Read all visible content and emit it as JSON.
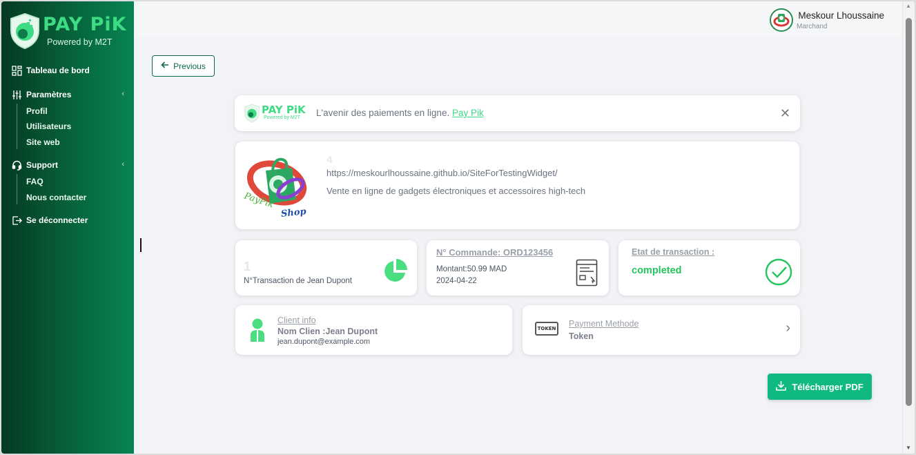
{
  "brand": {
    "name": "PAY PiK",
    "powered_by": "Powered by M2T"
  },
  "sidebar": {
    "dashboard": "Tableau de bord",
    "settings": {
      "label": "Paramètres",
      "items": [
        "Profil",
        "Utilisateurs",
        "Site web"
      ]
    },
    "support": {
      "label": "Support",
      "items": [
        "FAQ",
        "Nous contacter"
      ]
    },
    "logout": "Se déconnecter"
  },
  "header": {
    "user_name": "Meskour Lhoussaine",
    "user_role": "Marchand"
  },
  "previous_label": "Previous",
  "banner": {
    "text": "L'avenir des paiements en ligne.",
    "link": "Pay Pik",
    "mini_brand": "PAY PiK",
    "mini_powered": "Powered by M2T"
  },
  "shop": {
    "id": "4",
    "url": "https://meskourlhoussaine.github.io/SiteForTestingWidget/",
    "description": "Vente en ligne de gadgets électroniques et accessoires high-tech",
    "logo_text_1": "PayPik",
    "logo_text_2": "Shop"
  },
  "transaction_count": {
    "number": "1",
    "label": "N°Transaction de Jean Dupont"
  },
  "order": {
    "title": "N° Commande: ORD123456",
    "amount": "Montant:50.99 MAD",
    "date": "2024-04-22"
  },
  "transaction_state": {
    "title": "Etat de transaction :",
    "status": "completed"
  },
  "client": {
    "title": "Client info",
    "name": "Nom Clien :Jean Dupont",
    "email": "jean.dupont@example.com"
  },
  "payment": {
    "title": "Payment Methode",
    "value": "Token",
    "icon_text": "TOKEN"
  },
  "download_label": "Télécharger PDF",
  "colors": {
    "accent": "#10b981",
    "sidebar_dark": "#053a22",
    "sidebar_light": "#078453",
    "success": "#22c55e",
    "brand_green": "#3ddc84"
  }
}
